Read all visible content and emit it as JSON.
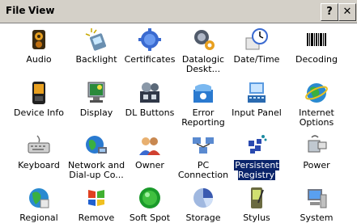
{
  "menubar": {
    "file_label": "File",
    "view_label": "View",
    "help_symbol": "?",
    "close_symbol": "✕"
  },
  "items": [
    {
      "label": "Audio",
      "icon": "speaker-icon"
    },
    {
      "label": "Backlight",
      "icon": "backlight-icon"
    },
    {
      "label": "Certificates",
      "icon": "certificates-icon"
    },
    {
      "label": "Datalogic Deskt...",
      "icon": "datalogic-desktop-icon"
    },
    {
      "label": "Date/Time",
      "icon": "clock-icon"
    },
    {
      "label": "Decoding",
      "icon": "barcode-icon"
    },
    {
      "label": "Device Info",
      "icon": "device-info-icon"
    },
    {
      "label": "Display",
      "icon": "display-icon"
    },
    {
      "label": "DL Buttons",
      "icon": "dl-buttons-icon"
    },
    {
      "label": "Error Reporting",
      "icon": "error-reporting-icon"
    },
    {
      "label": "Input Panel",
      "icon": "input-panel-icon"
    },
    {
      "label": "Internet Options",
      "icon": "internet-options-icon"
    },
    {
      "label": "Keyboard",
      "icon": "keyboard-icon"
    },
    {
      "label": "Network and Dial-up Co...",
      "icon": "network-icon"
    },
    {
      "label": "Owner",
      "icon": "owner-icon"
    },
    {
      "label": "PC Connection",
      "icon": "pc-connection-icon"
    },
    {
      "label": "Persistent Registry",
      "icon": "persistent-registry-icon",
      "selected": true
    },
    {
      "label": "Power",
      "icon": "power-icon"
    },
    {
      "label": "Regional",
      "icon": "regional-icon"
    },
    {
      "label": "Remove",
      "icon": "remove-programs-icon"
    },
    {
      "label": "Soft Spot",
      "icon": "soft-spot-icon"
    },
    {
      "label": "Storage",
      "icon": "storage-icon"
    },
    {
      "label": "Stylus",
      "icon": "stylus-icon"
    },
    {
      "label": "System",
      "icon": "system-icon"
    }
  ]
}
